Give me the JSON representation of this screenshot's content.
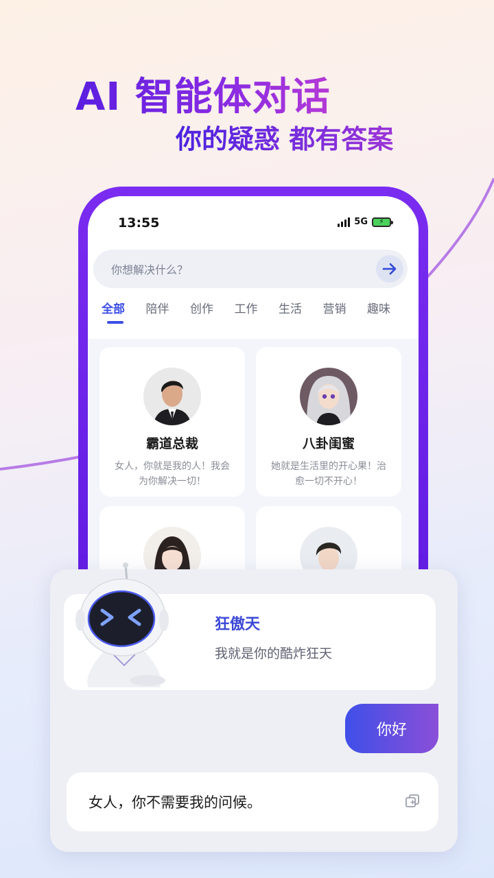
{
  "hero": {
    "title": "AI 智能体对话",
    "subtitle": "你的疑惑 都有答案"
  },
  "status_bar": {
    "time": "13:55",
    "network": "5G",
    "battery_icon": "battery-charging-icon"
  },
  "search": {
    "placeholder": "你想解决什么？",
    "submit_icon": "arrow-right-icon"
  },
  "tabs": [
    {
      "label": "全部",
      "active": true
    },
    {
      "label": "陪伴",
      "active": false
    },
    {
      "label": "创作",
      "active": false
    },
    {
      "label": "工作",
      "active": false
    },
    {
      "label": "生活",
      "active": false
    },
    {
      "label": "营销",
      "active": false
    },
    {
      "label": "趣味",
      "active": false
    }
  ],
  "agents": [
    {
      "name": "霸道总裁",
      "desc": "女人，你就是我的人！我会为你解决一切！"
    },
    {
      "name": "八卦闺蜜",
      "desc": "她就是生活里的开心果！治愈一切不开心！"
    }
  ],
  "chat": {
    "bot_name": "狂傲天",
    "bot_intro": "我就是你的酷炸狂天",
    "user_message": "你好",
    "bot_reply": "女人，你不需要我的问候。",
    "copy_icon": "copy-icon"
  },
  "colors": {
    "accent": "#3d4ee5",
    "phone_frame": "#6a22e8",
    "user_bubble_start": "#3f4fe8",
    "user_bubble_end": "#8a4fd8"
  }
}
